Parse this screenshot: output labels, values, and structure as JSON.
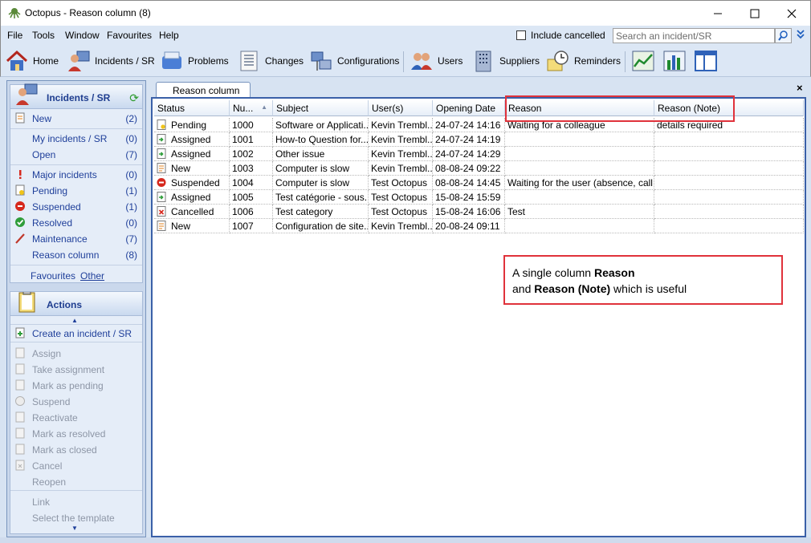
{
  "window": {
    "title": "Octopus - Reason column (8)"
  },
  "menu": [
    "File",
    "Tools",
    "Window",
    "Favourites",
    "Help"
  ],
  "include_cancelled_label": "Include cancelled",
  "search": {
    "placeholder": "Search an incident/SR"
  },
  "toolbar": {
    "home": "Home",
    "incidents": "Incidents / SR",
    "problems": "Problems",
    "changes": "Changes",
    "configurations": "Configurations",
    "users": "Users",
    "suppliers": "Suppliers",
    "reminders": "Reminders"
  },
  "incidents_pane": {
    "title": "Incidents / SR",
    "items": [
      {
        "label": "New",
        "count": "(2)"
      },
      {
        "label": "My incidents / SR",
        "count": "(0)"
      },
      {
        "label": "Open",
        "count": "(7)"
      },
      {
        "label": "Major incidents",
        "count": "(0)"
      },
      {
        "label": "Pending",
        "count": "(1)"
      },
      {
        "label": "Suspended",
        "count": "(1)"
      },
      {
        "label": "Resolved",
        "count": "(0)"
      },
      {
        "label": "Maintenance",
        "count": "(7)"
      },
      {
        "label": "Reason column",
        "count": "(8)"
      }
    ],
    "favourites": "Favourites",
    "other": "Other"
  },
  "actions_pane": {
    "title": "Actions",
    "create": "Create an incident / SR",
    "items": [
      "Assign",
      "Take assignment",
      "Mark as pending",
      "Suspend",
      "Reactivate",
      "Mark as resolved",
      "Mark as closed",
      "Cancel",
      "Reopen"
    ],
    "extra": [
      "Link",
      "Select the template"
    ]
  },
  "tab": {
    "label": "Reason column (8)"
  },
  "grid": {
    "columns": [
      "Status",
      "Nu...",
      "Subject",
      "User(s)",
      "Opening Date",
      "Reason",
      "Reason (Note)"
    ],
    "rows": [
      [
        "Pending",
        "1000",
        "Software or Applicati...",
        "Kevin Trembl...",
        "24-07-24 14:16",
        "Waiting for a colleague",
        "details required"
      ],
      [
        "Assigned",
        "1001",
        "How-to Question for...",
        "Kevin Trembl...",
        "24-07-24 14:19",
        "",
        ""
      ],
      [
        "Assigned",
        "1002",
        "Other issue",
        "Kevin Trembl...",
        "24-07-24 14:29",
        "",
        ""
      ],
      [
        "New",
        "1003",
        "Computer is slow",
        "Kevin Trembl...",
        "08-08-24 09:22",
        "",
        ""
      ],
      [
        "Suspended",
        "1004",
        "Computer is slow",
        "Test Octopus",
        "08-08-24 14:45",
        "Waiting for the user (absence, call...",
        ""
      ],
      [
        "Assigned",
        "1005",
        "Test catégorie - sous...",
        "Test Octopus",
        "15-08-24 15:59",
        "",
        ""
      ],
      [
        "Cancelled",
        "1006",
        "Test category",
        "Test Octopus",
        "15-08-24 16:06",
        "Test",
        ""
      ],
      [
        "New",
        "1007",
        "Configuration de site...",
        "Kevin Trembl...",
        "20-08-24 09:11",
        "",
        ""
      ]
    ]
  },
  "note": {
    "line1_prefix": "A single column ",
    "line1_bold": "Reason",
    "line2_prefix": "and ",
    "line2_bold": "Reason (Note)",
    "line2_suffix": " which is useful"
  }
}
